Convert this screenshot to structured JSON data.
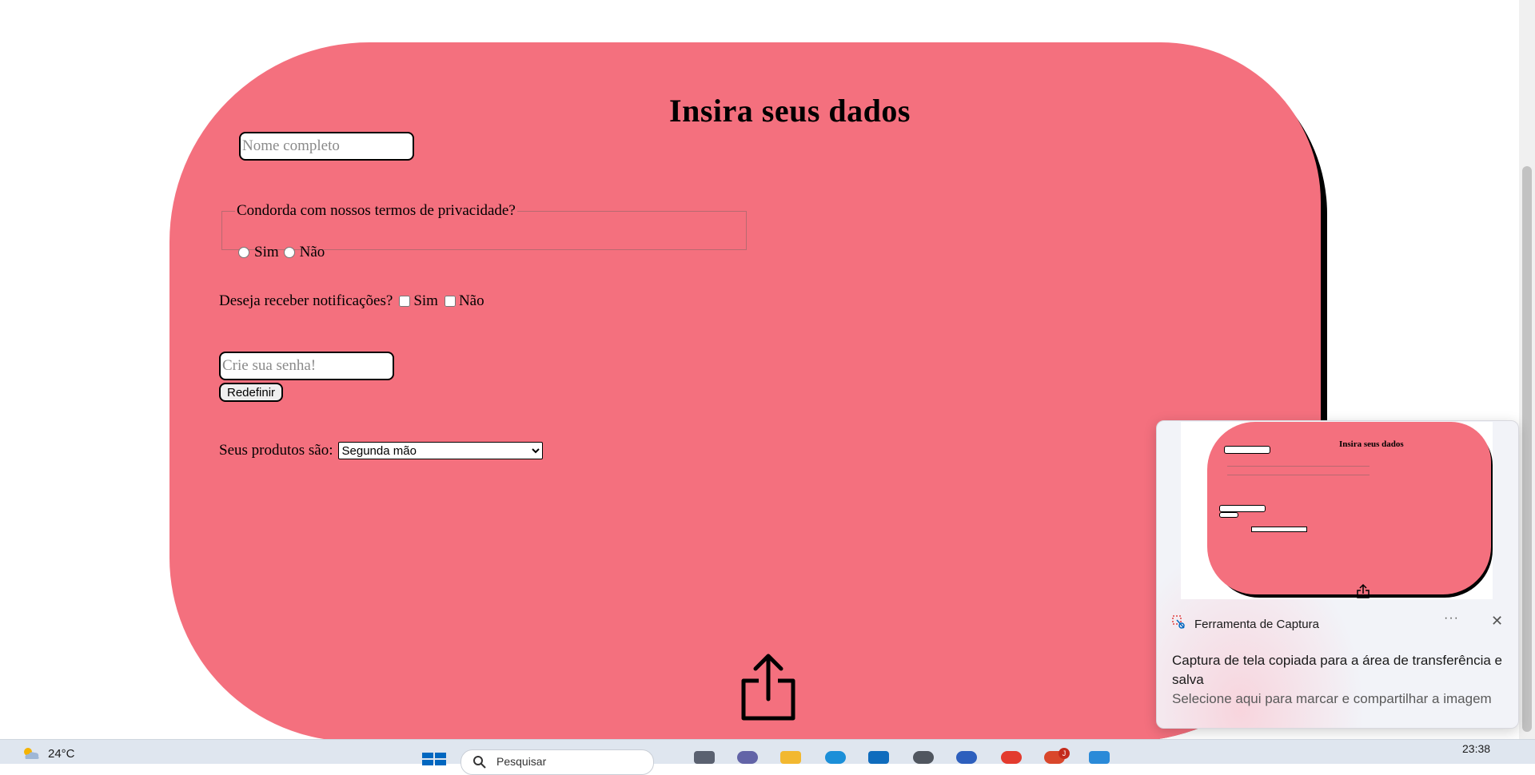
{
  "form": {
    "title": "Insira seus dados",
    "name_placeholder": "Nome completo",
    "privacy_legend": "Condorda com nossos termos de privacidade?",
    "privacy_yes": "Sim",
    "privacy_no": "Não",
    "notifications_label": "Deseja receber notificações?",
    "notifications_yes": "Sim",
    "notifications_no": "Não",
    "password_placeholder": "Crie sua senha!",
    "reset_label": "Redefinir",
    "products_label": "Seus produtos são:",
    "products_selected": "Segunda mão"
  },
  "notification": {
    "app_name": "Ferramenta de Captura",
    "more": "···",
    "close": "✕",
    "message": "Captura de tela copiada para a área de transferência e salva",
    "subtext": "Selecione aqui para marcar e compartilhar a imagem",
    "thumbnail_title": "Insira seus dados"
  },
  "taskbar": {
    "temperature": "24°C",
    "search_placeholder": "Pesquisar",
    "time": "23:38",
    "badge_count": "J"
  },
  "colors": {
    "card": "#f4707e",
    "accent_blue": "#0067c0"
  },
  "icons": [
    "share-icon",
    "weather-icon",
    "windows-start-icon",
    "search-icon",
    "snipping-tool-icon",
    "close-icon",
    "more-icon"
  ]
}
